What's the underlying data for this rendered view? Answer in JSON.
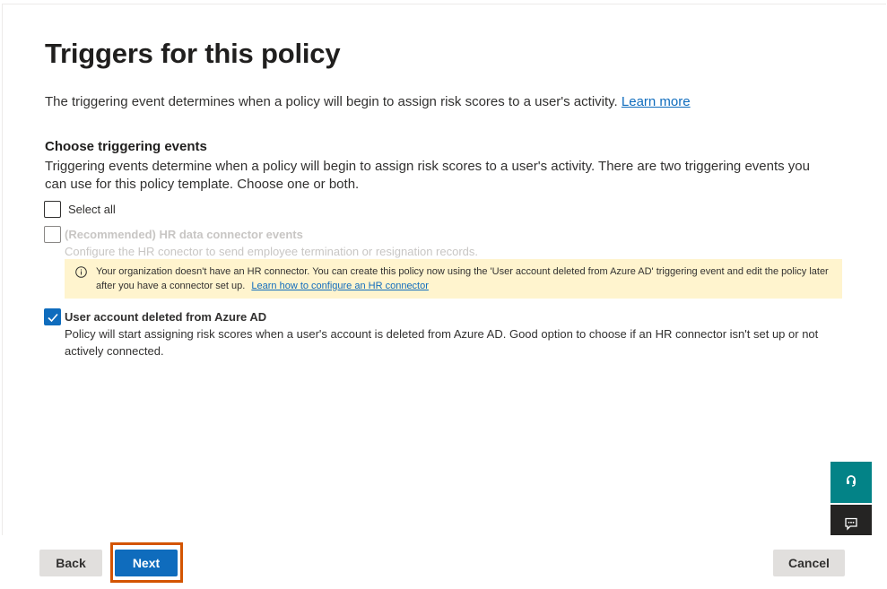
{
  "page": {
    "title": "Triggers for this policy",
    "description": "The triggering event determines when a policy will begin to assign risk scores to a user's activity.",
    "learn_more": "Learn more"
  },
  "section": {
    "title": "Choose triggering events",
    "description": "Triggering events determine when a policy will begin to assign risk scores to a user's activity. There are two triggering events you can use for this policy template. Choose one or both."
  },
  "options": {
    "select_all": {
      "label": "Select all",
      "checked": false
    },
    "hr_connector": {
      "label": "(Recommended) HR data connector events",
      "description": "Configure the HR conector to send employee termination or resignation records.",
      "checked": false,
      "disabled": true
    },
    "warning": {
      "text": "Your organization doesn't have an HR connector. You can create this policy now using the 'User account deleted from Azure AD' triggering event and edit the policy later after you have a connector set up.",
      "link": "Learn how to configure an HR connector"
    },
    "azure_ad": {
      "label": "User account deleted from Azure AD",
      "description": "Policy will start assigning risk scores when a user's account is deleted from Azure AD. Good option to choose if an HR connector isn't set up or not actively connected.",
      "checked": true
    }
  },
  "footer": {
    "back": "Back",
    "next": "Next",
    "cancel": "Cancel"
  },
  "side_buttons": {
    "help_icon": "headset-icon",
    "feedback_icon": "feedback-icon"
  },
  "colors": {
    "accent": "#0f6cbd",
    "warning_bg": "#fff4ce",
    "highlight": "#d35400",
    "teal": "#038387"
  }
}
